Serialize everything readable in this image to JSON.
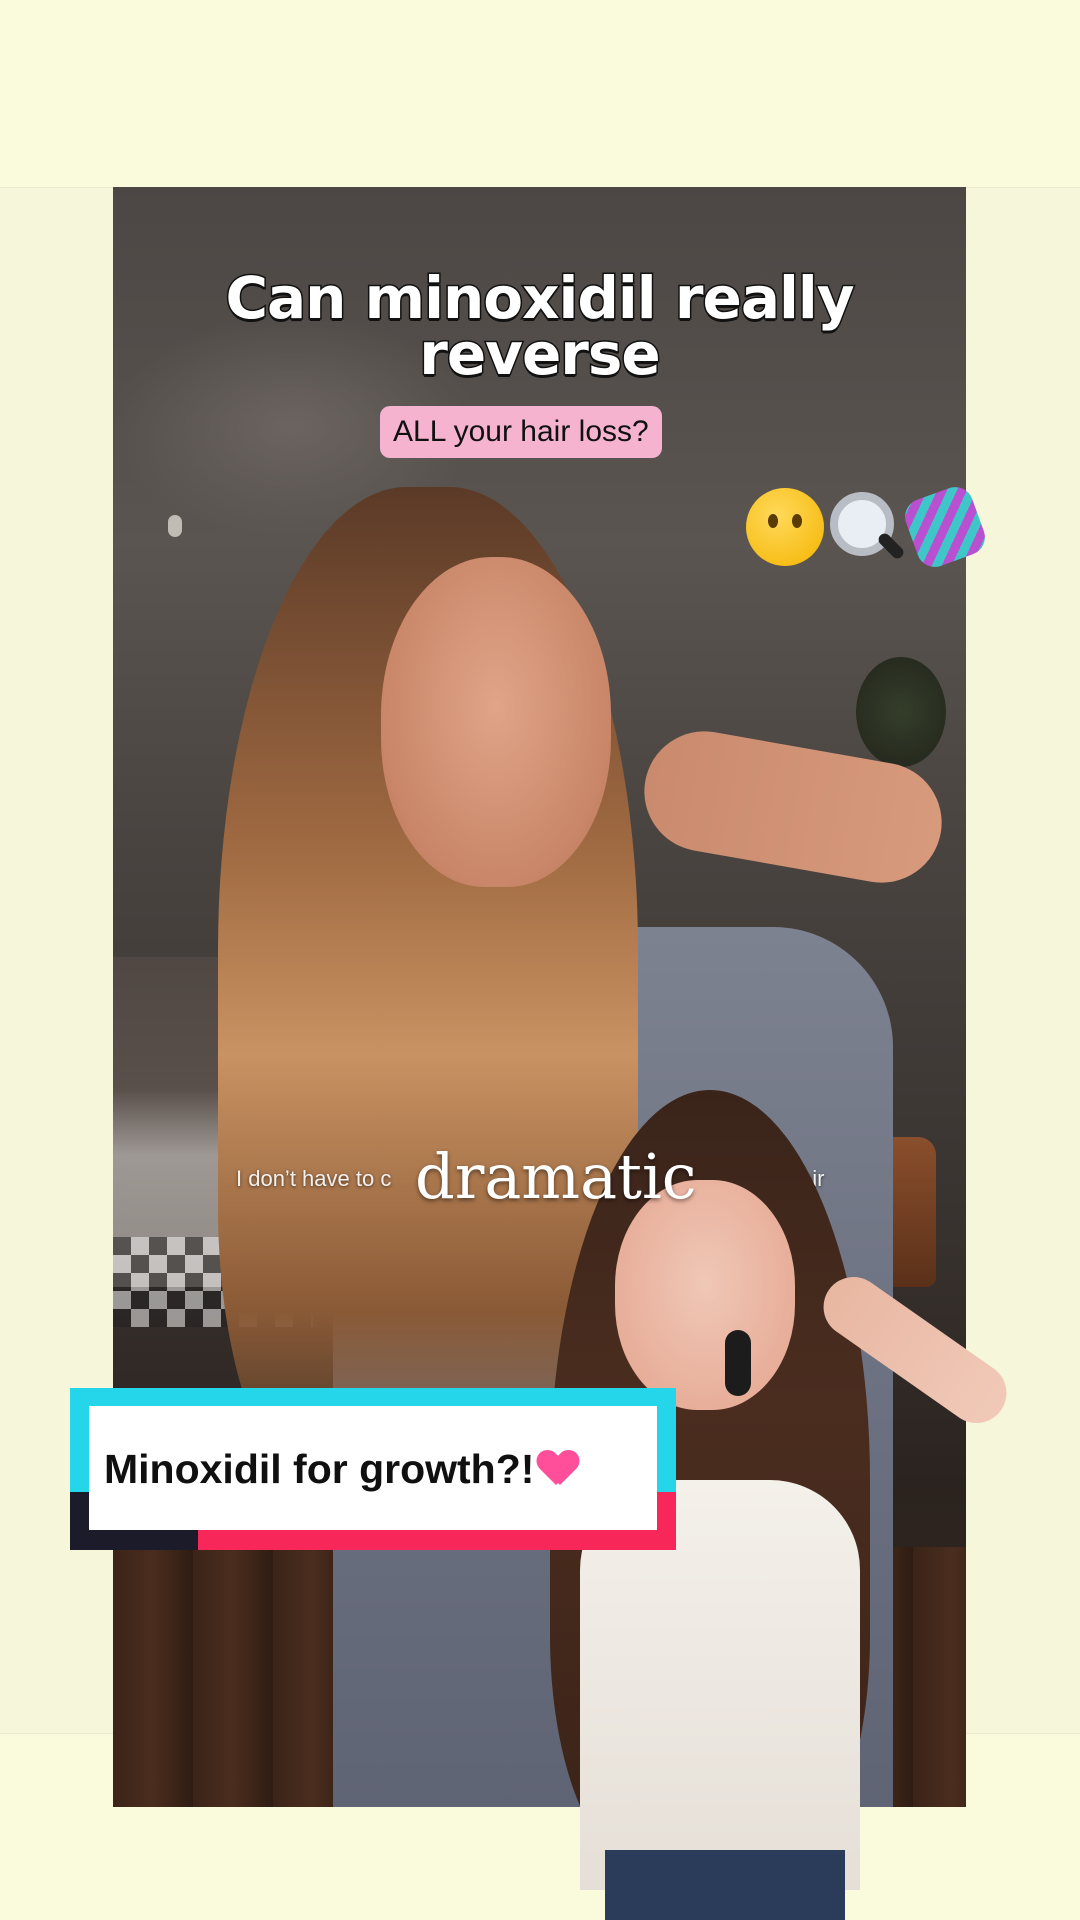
{
  "video": {
    "headline_line1": "Can minoxidil really",
    "headline_line2": "reverse",
    "subheadline": "ALL your hair loss?",
    "emoji_icons": [
      "thinking-face-icon",
      "magnifying-glass-icon",
      "dna-icon"
    ]
  },
  "captions": {
    "spoken_left": "I don’t have to c",
    "spoken_right": "air",
    "emphasis_word": "dramatic"
  },
  "banner": {
    "text": "Minoxidil for growth?!",
    "icon": "sparkling-heart-icon"
  },
  "colors": {
    "background": "#fafadd",
    "pill": "#f6b3d0",
    "banner_cyan": "#25d6ea",
    "banner_red": "#f7275a",
    "banner_dark": "#1c1b29"
  }
}
